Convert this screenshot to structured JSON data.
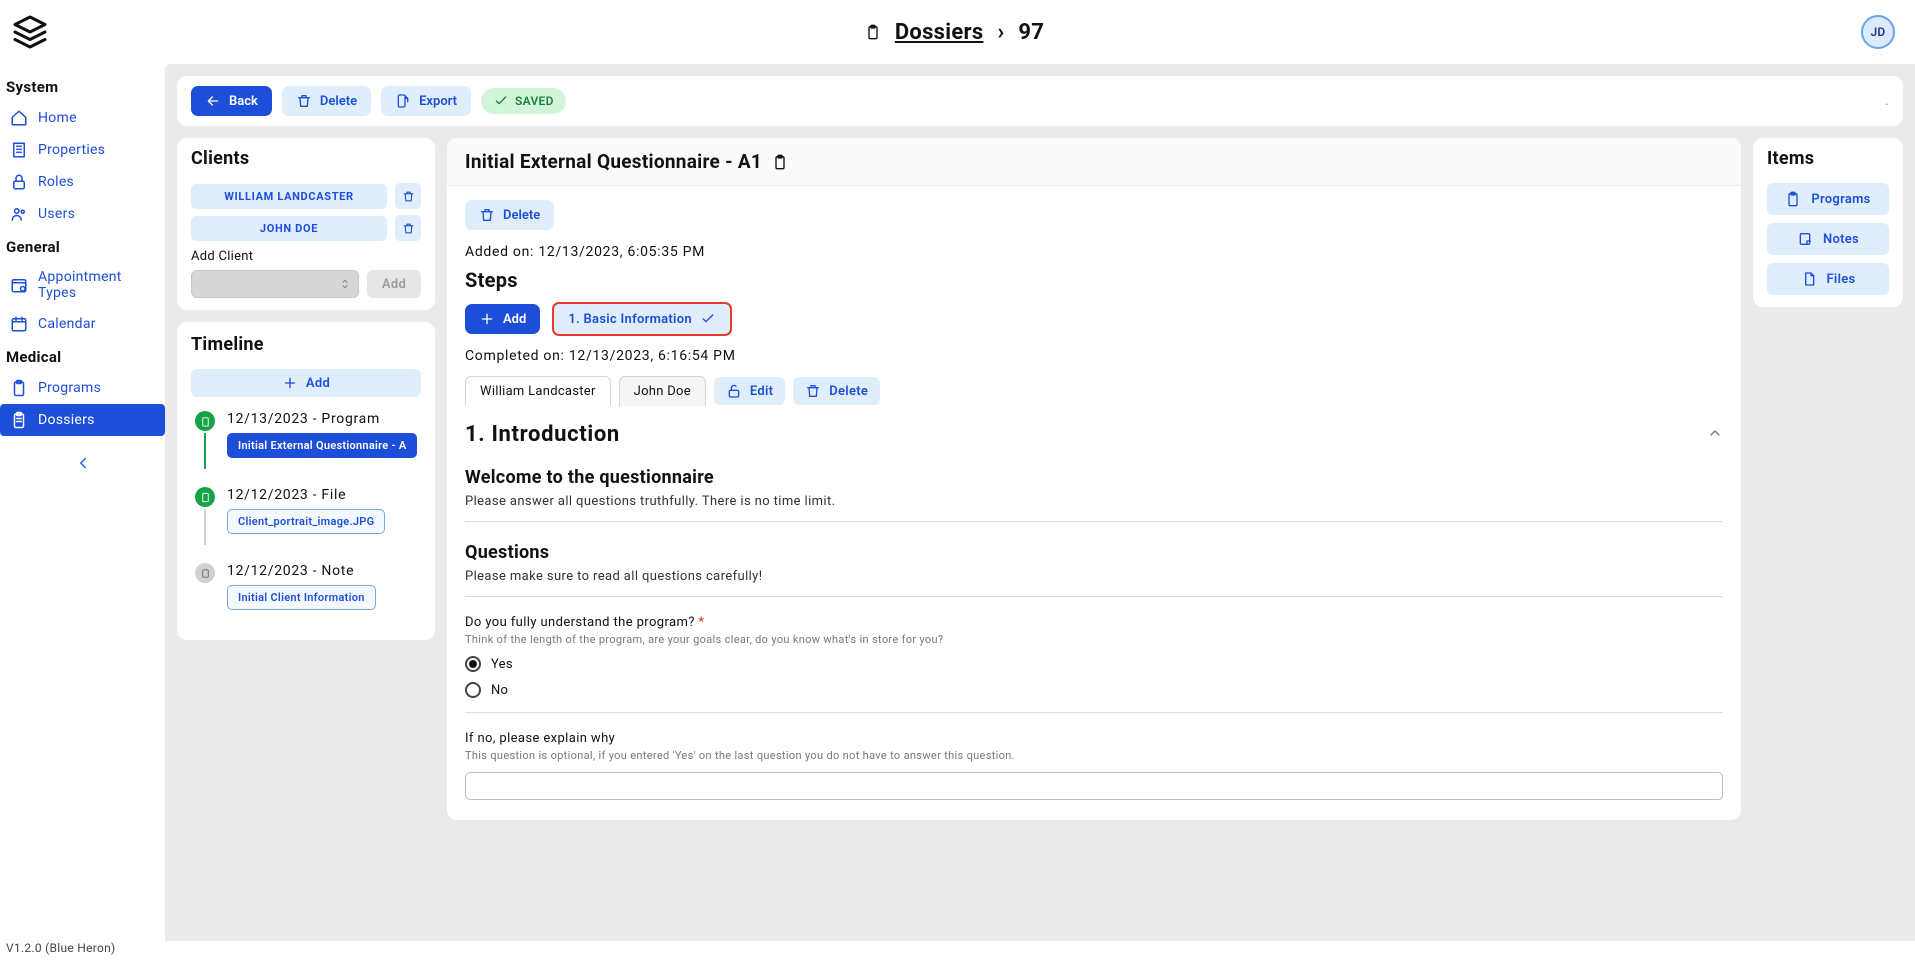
{
  "header": {
    "breadcrumb_link": "Dossiers",
    "breadcrumb_sep": "›",
    "breadcrumb_current": "97",
    "avatar_initials": "JD"
  },
  "sidebar": {
    "groups": [
      {
        "label": "System",
        "items": [
          {
            "label": "Home"
          },
          {
            "label": "Properties"
          },
          {
            "label": "Roles"
          },
          {
            "label": "Users"
          }
        ]
      },
      {
        "label": "General",
        "items": [
          {
            "label": "Appointment Types"
          },
          {
            "label": "Calendar"
          }
        ]
      },
      {
        "label": "Medical",
        "items": [
          {
            "label": "Programs"
          },
          {
            "label": "Dossiers"
          }
        ]
      }
    ],
    "version": "V1.2.0 (Blue Heron)"
  },
  "toolbar": {
    "back": "Back",
    "delete": "Delete",
    "export": "Export",
    "saved": "SAVED"
  },
  "clients": {
    "title": "Clients",
    "items": [
      "WILLIAM LANDCASTER",
      "JOHN DOE"
    ],
    "add_label": "Add Client",
    "add_button": "Add"
  },
  "timeline": {
    "title": "Timeline",
    "add": "Add",
    "items": [
      {
        "date": "12/13/2023",
        "kind": "Program",
        "sub": "Initial External Questionnaire - A",
        "green": true,
        "filled": true
      },
      {
        "date": "12/12/2023",
        "kind": "File",
        "sub": "Client_portrait_image.JPG",
        "green": true,
        "filled": false
      },
      {
        "date": "12/12/2023",
        "kind": "Note",
        "sub": "Initial Client Information",
        "green": false,
        "filled": false
      }
    ]
  },
  "program": {
    "title": "Initial External Questionnaire - A1",
    "delete": "Delete",
    "added_on_label": "Added on:",
    "added_on_value": "12/13/2023, 6:05:35 PM",
    "steps_label": "Steps",
    "add_step": "Add",
    "step1": "1. Basic Information",
    "completed_on_label": "Completed on:",
    "completed_on_value": "12/13/2023, 6:16:54 PM",
    "tabs": [
      "William Landcaster",
      "John Doe"
    ],
    "edit": "Edit",
    "delete2": "Delete",
    "section_title": "1. Introduction",
    "welcome_title": "Welcome to the questionnaire",
    "welcome_desc": "Please answer all questions truthfully. There is no time limit.",
    "questions_title": "Questions",
    "questions_desc": "Please make sure to read all questions carefully!",
    "q1_label": "Do you fully understand the program?",
    "q1_hint": "Think of the length of the program, are your goals clear, do you know what's in store for you?",
    "opt_yes": "Yes",
    "opt_no": "No",
    "q2_label": "If no, please explain why",
    "q2_hint": "This question is optional, if you entered 'Yes' on the last question you do not have to answer this question."
  },
  "items": {
    "title": "Items",
    "entries": [
      "Programs",
      "Notes",
      "Files"
    ]
  }
}
